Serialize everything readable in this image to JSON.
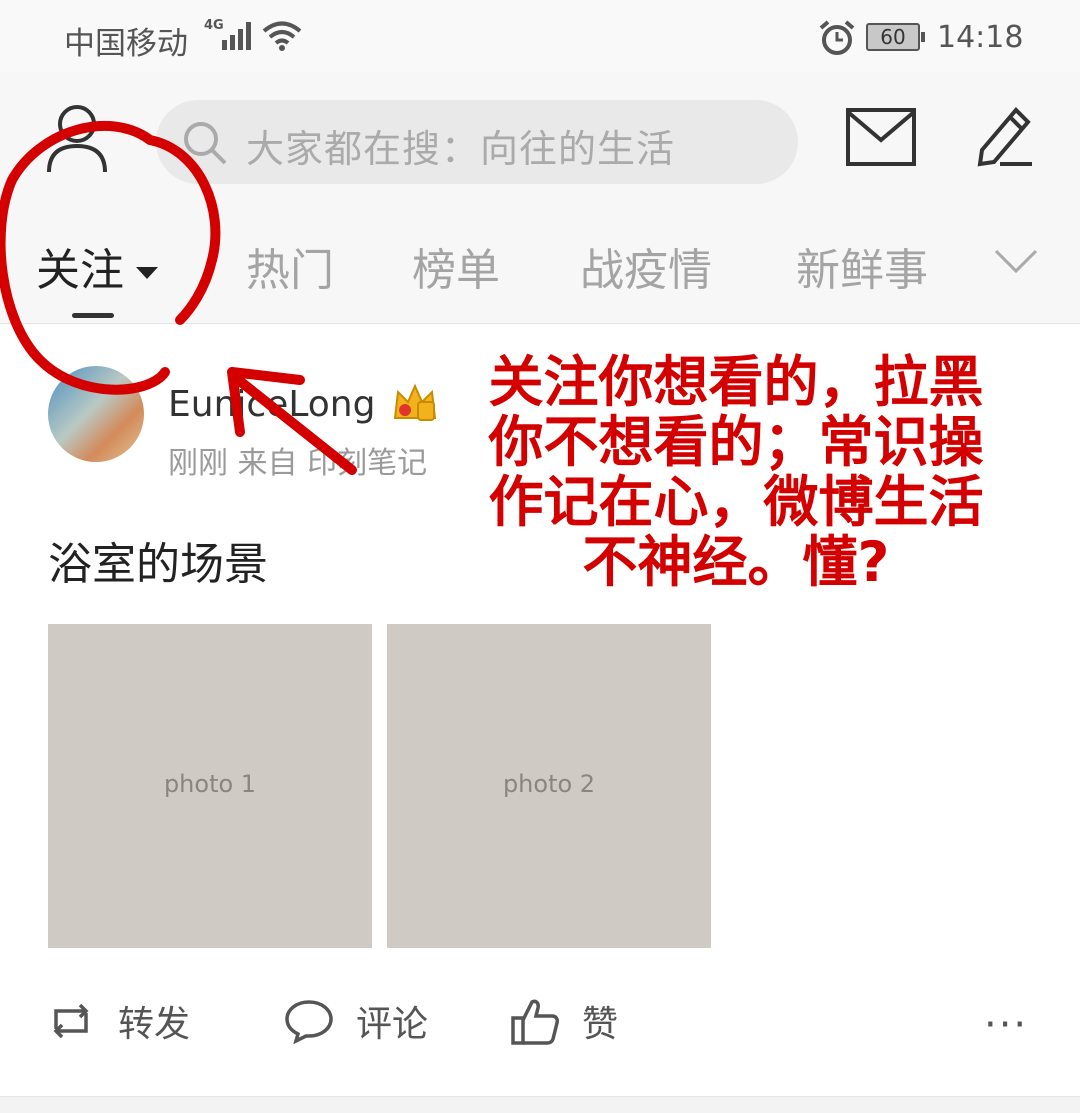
{
  "status_bar": {
    "carrier": "中国移动",
    "network": "4G",
    "battery": "60",
    "time": "14:18"
  },
  "header": {
    "search_placeholder": "大家都在搜：向往的生活",
    "tabs": [
      {
        "label": "关注",
        "active": true
      },
      {
        "label": "热门",
        "active": false
      },
      {
        "label": "榜单",
        "active": false
      },
      {
        "label": "战疫情",
        "active": false
      },
      {
        "label": "新鲜事",
        "active": false
      }
    ]
  },
  "post": {
    "author": "EuniceLong",
    "time": "刚刚",
    "source": "来自 印刻笔记",
    "text": "浴室的场景",
    "images": [
      {
        "alt": "photo 1"
      },
      {
        "alt": "photo 2"
      }
    ],
    "actions": {
      "repost": "转发",
      "comment": "评论",
      "like": "赞"
    }
  },
  "annotation": {
    "lines": [
      "关注你想看的，拉黑",
      "你不想看的；常识操",
      "作记在心，微博生活",
      "不神经。懂?"
    ]
  },
  "colors": {
    "annotation": "#d40000",
    "tab_active": "#222222",
    "tab_inactive": "#a4a4a4",
    "background": "#ffffff",
    "header_bg": "#f7f7f7"
  }
}
